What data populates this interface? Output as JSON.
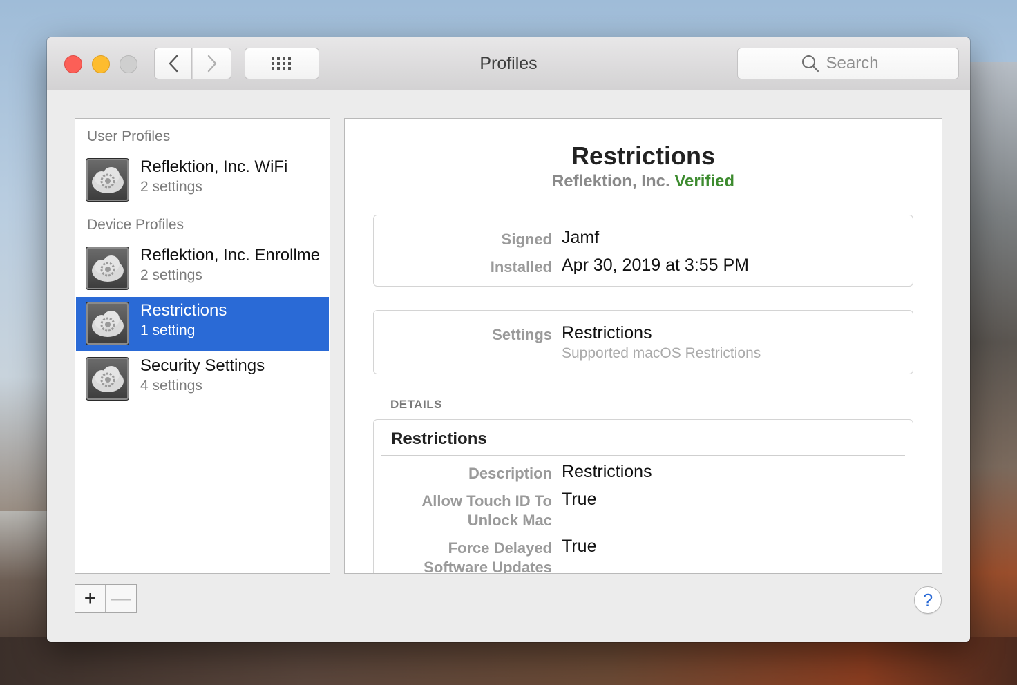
{
  "window": {
    "title": "Profiles"
  },
  "toolbar": {
    "search_placeholder": "Search"
  },
  "sidebar": {
    "user_section": "User Profiles",
    "device_section": "Device Profiles",
    "user_items": [
      {
        "name": "Reflektion, Inc. WiFi",
        "count": "2 settings"
      }
    ],
    "device_items": [
      {
        "name": "Reflektion, Inc. Enrollme",
        "count": "2 settings"
      },
      {
        "name": "Restrictions",
        "count": "1 setting",
        "selected": true
      },
      {
        "name": "Security Settings",
        "count": "4 settings"
      }
    ]
  },
  "detail": {
    "title": "Restrictions",
    "org": "Reflektion, Inc.",
    "status": "Verified",
    "signed_label": "Signed",
    "signed_value": "Jamf",
    "installed_label": "Installed",
    "installed_value": "Apr 30, 2019 at 3:55 PM",
    "settings_label": "Settings",
    "settings_value": "Restrictions",
    "settings_sub": "Supported macOS Restrictions",
    "details_header": "DETAILS",
    "details_card": {
      "title": "Restrictions",
      "rows": [
        {
          "label": "Description",
          "value": "Restrictions"
        },
        {
          "label": "Allow Touch ID To Unlock Mac",
          "value": "True"
        },
        {
          "label": "Force Delayed Software Updates",
          "value": "True"
        }
      ]
    }
  },
  "footer": {
    "add": "+",
    "remove": "—",
    "help": "?"
  },
  "colors": {
    "selection": "#2a6ad6",
    "verified": "#3d8b2f",
    "close": "#fc5f57",
    "minimize": "#fdbc2e"
  }
}
